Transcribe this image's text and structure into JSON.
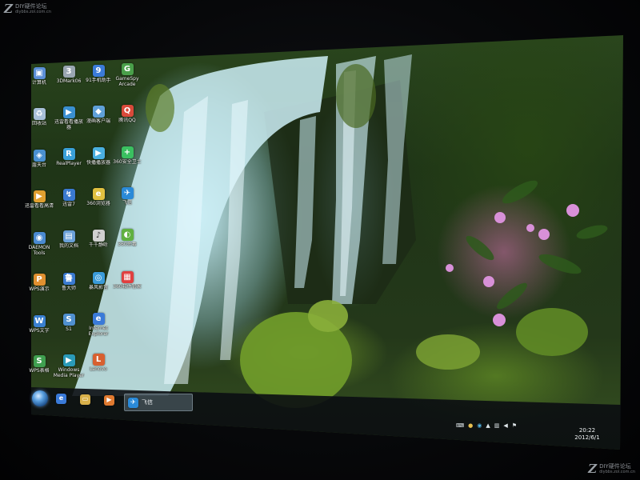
{
  "watermark": {
    "logo": "Z",
    "title": "DIY硬件论坛",
    "url": "diybbs.zol.com.cn"
  },
  "desktop_icons": [
    {
      "label": "计算机",
      "icon": "computer-icon",
      "color": "#5b8fd6"
    },
    {
      "label": "3DMark06",
      "icon": "3dmark-icon",
      "color": "#9aa6b2"
    },
    {
      "label": "91手机助手",
      "icon": "phone-assistant-icon",
      "color": "#3b7bd8"
    },
    {
      "label": "GameSpy Arcade",
      "icon": "gamespy-icon",
      "color": "#4aa04a"
    },
    {
      "label": "回收站",
      "icon": "recycle-bin-icon",
      "color": "#a8c0d8"
    },
    {
      "label": "迅雷看看播放器",
      "icon": "video-player-icon",
      "color": "#3a8fd0"
    },
    {
      "label": "漫画客户端",
      "icon": "comic-app-icon",
      "color": "#5fa0d8"
    },
    {
      "label": "腾讯QQ",
      "icon": "qq-icon",
      "color": "#d94a3a"
    },
    {
      "label": "露天台",
      "icon": "network-icon",
      "color": "#4a90d0"
    },
    {
      "label": "RealPlayer",
      "icon": "realplayer-icon",
      "color": "#3aa0d8"
    },
    {
      "label": "快播播放器",
      "icon": "player-icon",
      "color": "#4ab0e0"
    },
    {
      "label": "360安全卫士",
      "icon": "security-icon",
      "color": "#3ac060"
    },
    {
      "label": "迅雷看看高清",
      "icon": "hd-video-icon",
      "color": "#e0a030"
    },
    {
      "label": "迅雷7",
      "icon": "thunder-icon",
      "color": "#3a7ad0"
    },
    {
      "label": "360浏览器",
      "icon": "browser-icon",
      "color": "#e0c040"
    },
    {
      "label": "飞信",
      "icon": "fetion-icon",
      "color": "#2a8ad8"
    },
    {
      "label": "DAEMON Tools",
      "icon": "daemon-tools-icon",
      "color": "#4a8ad0"
    },
    {
      "label": "我的文档",
      "icon": "documents-icon",
      "color": "#6aa0d8"
    },
    {
      "label": "千千静听",
      "icon": "music-icon",
      "color": "#d0d0d0"
    },
    {
      "label": "360杀毒",
      "icon": "antivirus-icon",
      "color": "#60b040"
    },
    {
      "label": "WPS演示",
      "icon": "wps-presentation-icon",
      "color": "#e09030"
    },
    {
      "label": "鲁大师",
      "icon": "ludashi-icon",
      "color": "#3a7ad0"
    },
    {
      "label": "暴风影音",
      "icon": "storm-player-icon",
      "color": "#3a9ad8"
    },
    {
      "label": "360软件管家",
      "icon": "software-manager-icon",
      "color": "#e04040"
    },
    {
      "label": "WPS文字",
      "icon": "wps-writer-icon",
      "color": "#3a80d0"
    },
    {
      "label": "S1",
      "icon": "app-icon",
      "color": "#5090d0"
    },
    {
      "label": "Internet Explorer",
      "icon": "internet-explorer-icon",
      "color": "#3a7ad8"
    },
    {
      "label": "WPS表格",
      "icon": "wps-spreadsheet-icon",
      "color": "#40a050"
    },
    {
      "label": "Windows Media Player",
      "icon": "media-player-icon",
      "color": "#2a9ab8"
    },
    {
      "label": "Lenovo",
      "icon": "lenovo-icon",
      "color": "#d86030"
    }
  ],
  "taskbar": {
    "start_icon": "windows-start-icon",
    "pinned": [
      {
        "icon": "internet-explorer-icon",
        "color": "#3a7ad8"
      },
      {
        "icon": "folder-icon",
        "color": "#d8b04a"
      },
      {
        "icon": "media-player-icon",
        "color": "#e07a30"
      }
    ],
    "active_window": {
      "label": "飞信",
      "icon": "fetion-icon",
      "color": "#2a8ad8"
    },
    "tray_icons": [
      "keyboard-icon",
      "qq-tray-icon",
      "security-tray-icon",
      "chevron-up-icon",
      "network-tray-icon",
      "volume-icon",
      "flag-icon"
    ],
    "clock_time": "20:22",
    "clock_date": "2012/6/1"
  }
}
